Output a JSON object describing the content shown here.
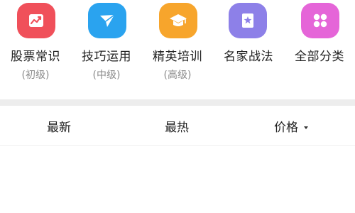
{
  "categories": [
    {
      "label": "股票常识",
      "level": "(初级)",
      "icon": "chart-trend-icon",
      "color": "#f0505a"
    },
    {
      "label": "技巧运用",
      "level": "(中级)",
      "icon": "paper-plane-icon",
      "color": "#2aa3ef"
    },
    {
      "label": "精英培训",
      "level": "(高级)",
      "icon": "graduation-cap-icon",
      "color": "#f7a52c"
    },
    {
      "label": "名家战法",
      "level": "",
      "icon": "bookmark-star-icon",
      "color": "#8d80e8"
    },
    {
      "label": "全部分类",
      "level": "",
      "icon": "grid-dots-icon",
      "color": "#e565d8"
    }
  ],
  "sort_tabs": {
    "latest": "最新",
    "hottest": "最热",
    "price": "价格"
  }
}
